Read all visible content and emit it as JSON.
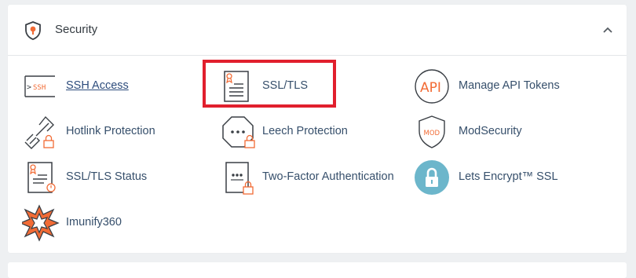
{
  "section": {
    "title": "Security",
    "icon": "shield-lock-icon",
    "collapse_icon": "chevron-up-icon"
  },
  "items": [
    {
      "label": "SSH Access",
      "icon": "ssh-terminal-icon"
    },
    {
      "label": "SSL/TLS",
      "icon": "certificate-document-icon"
    },
    {
      "label": "Manage API Tokens",
      "icon": "api-icon"
    },
    {
      "label": "Hotlink Protection",
      "icon": "broken-link-lock-icon"
    },
    {
      "label": "Leech Protection",
      "icon": "octagon-lock-icon"
    },
    {
      "label": "ModSecurity",
      "icon": "mod-shield-icon"
    },
    {
      "label": "SSL/TLS Status",
      "icon": "certificate-status-icon"
    },
    {
      "label": "Two-Factor Authentication",
      "icon": "password-document-lock-icon"
    },
    {
      "label": "Lets Encrypt™ SSL",
      "icon": "padlock-circle-icon"
    },
    {
      "label": "Imunify360",
      "icon": "imunify-star-icon"
    }
  ],
  "colors": {
    "accent_orange": "#f26b35",
    "icon_dark": "#3a3f45",
    "label_blue": "#364f6b",
    "highlight_red": "#e11f2d",
    "lets_encrypt_blue": "#6cb6cb"
  }
}
